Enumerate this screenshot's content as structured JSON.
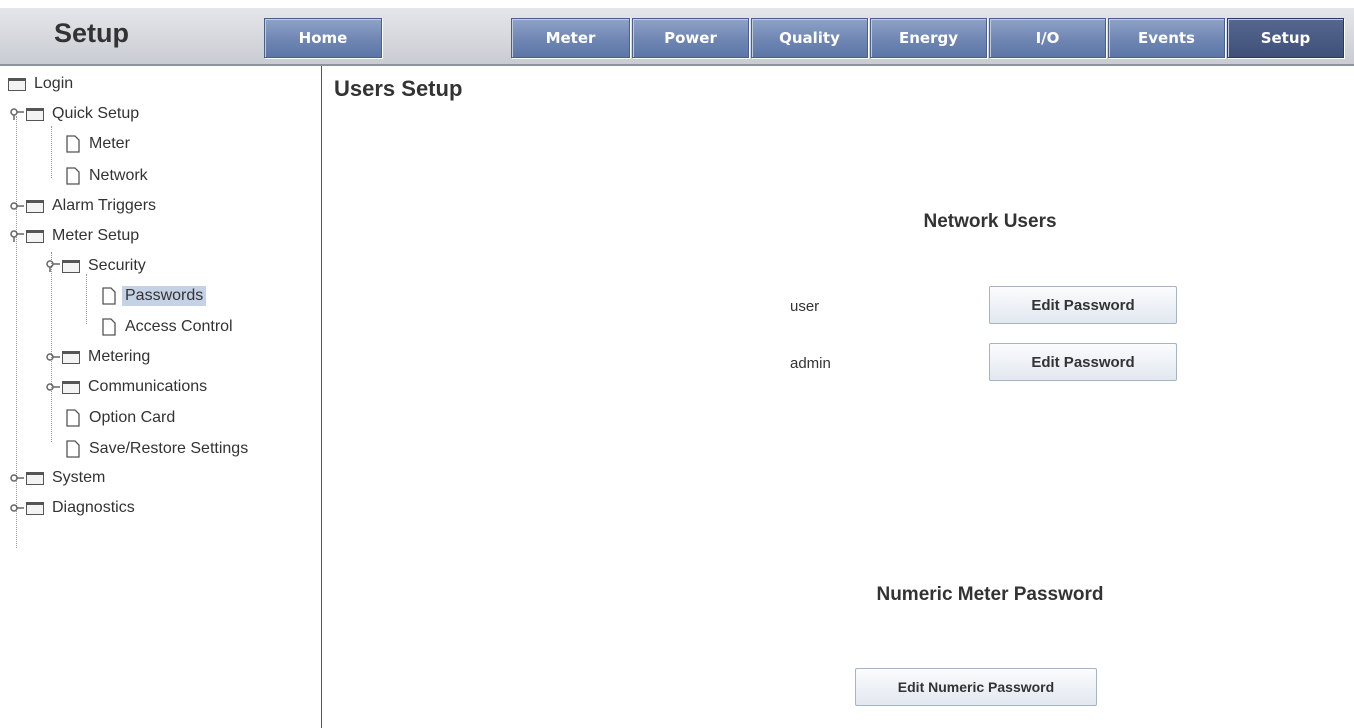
{
  "header": {
    "title": "Setup",
    "nav": [
      "Home",
      "Meter",
      "Power",
      "Quality",
      "Energy",
      "I/O",
      "Events",
      "Setup"
    ],
    "active": "Setup",
    "accent_color": "#6f86b3",
    "active_color": "#3f5079"
  },
  "sidebar": {
    "items": [
      {
        "label": "Login",
        "icon": "folder-icon"
      },
      {
        "label": "Quick Setup",
        "icon": "folder-icon",
        "expanded": true
      },
      {
        "label": "Meter",
        "icon": "page-icon"
      },
      {
        "label": "Network",
        "icon": "page-icon"
      },
      {
        "label": "Alarm Triggers",
        "icon": "folder-icon",
        "expanded": false
      },
      {
        "label": "Meter Setup",
        "icon": "folder-icon",
        "expanded": true
      },
      {
        "label": "Security",
        "icon": "folder-icon",
        "expanded": true
      },
      {
        "label": "Passwords",
        "icon": "page-icon",
        "selected": true
      },
      {
        "label": "Access Control",
        "icon": "page-icon"
      },
      {
        "label": "Metering",
        "icon": "folder-icon",
        "expanded": false
      },
      {
        "label": "Communications",
        "icon": "folder-icon",
        "expanded": false
      },
      {
        "label": "Option Card",
        "icon": "page-icon"
      },
      {
        "label": "Save/Restore Settings",
        "icon": "page-icon"
      },
      {
        "label": "System",
        "icon": "folder-icon",
        "expanded": false
      },
      {
        "label": "Diagnostics",
        "icon": "folder-icon",
        "expanded": false
      }
    ],
    "selected_color": "#c5d1e4"
  },
  "main": {
    "title": "Users Setup",
    "network_users": {
      "heading": "Network Users",
      "users": [
        {
          "name": "user",
          "button": "Edit Password"
        },
        {
          "name": "admin",
          "button": "Edit Password"
        }
      ]
    },
    "numeric": {
      "heading": "Numeric Meter Password",
      "button": "Edit Numeric Password"
    }
  }
}
